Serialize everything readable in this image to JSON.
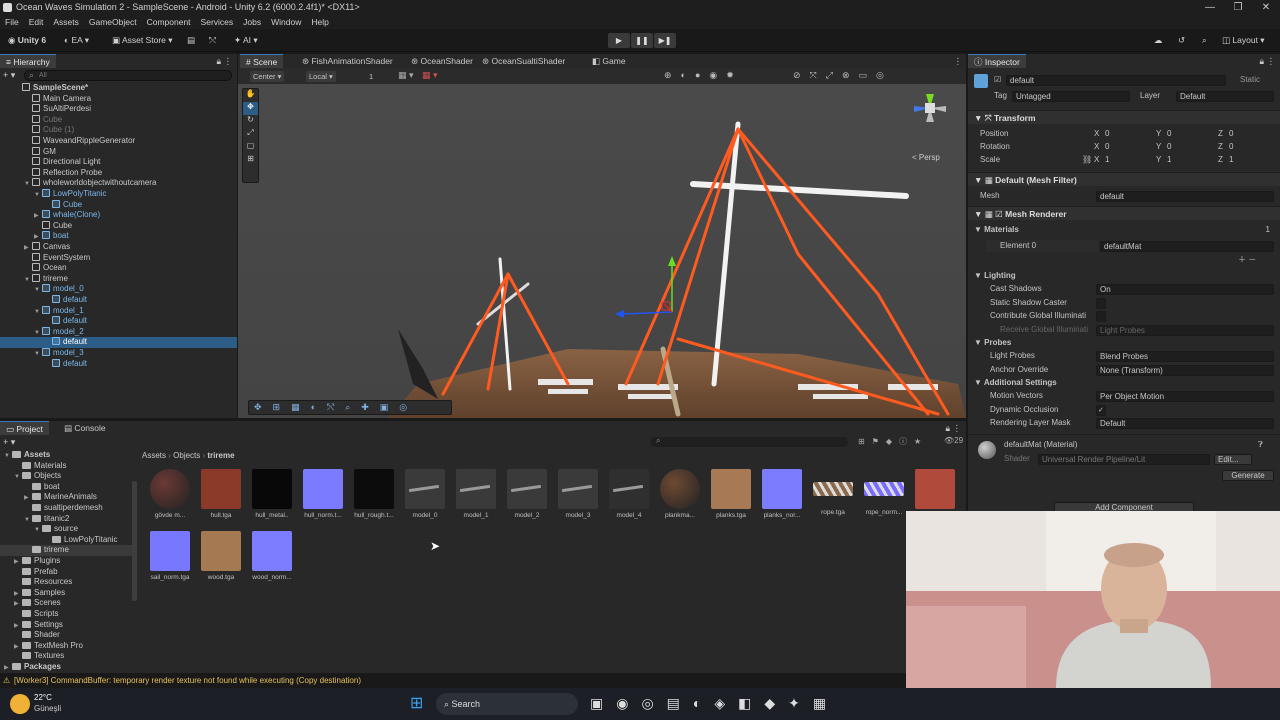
{
  "window": {
    "title": "Ocean Waves Simulation 2 - SampleScene - Android - Unity 6.2 (6000.2.4f1)* <DX11>",
    "controls": [
      "—",
      "❐",
      "✕"
    ]
  },
  "menu": [
    "File",
    "Edit",
    "Assets",
    "GameObject",
    "Component",
    "Services",
    "Jobs",
    "Window",
    "Help"
  ],
  "toolbar": {
    "unity": "Unity 6",
    "account": "EA",
    "asset_store": "Asset Store",
    "ai": "AI",
    "layout": "Layout"
  },
  "hierarchy": {
    "title": "Hierarchy",
    "search_placeholder": "All",
    "items": [
      {
        "label": "SampleScene*",
        "depth": 0,
        "style": "scene"
      },
      {
        "label": "Main Camera",
        "depth": 1,
        "style": ""
      },
      {
        "label": "SuAltiPerdesi",
        "depth": 1,
        "style": ""
      },
      {
        "label": "Cube",
        "depth": 1,
        "style": "dim"
      },
      {
        "label": "Cube (1)",
        "depth": 1,
        "style": "dim"
      },
      {
        "label": "WaveandRippleGenerator",
        "depth": 1,
        "style": ""
      },
      {
        "label": "GM",
        "depth": 1,
        "style": ""
      },
      {
        "label": "Directional Light",
        "depth": 1,
        "style": ""
      },
      {
        "label": "Reflection Probe",
        "depth": 1,
        "style": ""
      },
      {
        "label": "wholeworldobjectwithoutcamera",
        "depth": 1,
        "style": "",
        "arrow": "▼"
      },
      {
        "label": "LowPolyTitanic",
        "depth": 2,
        "style": "blue",
        "arrow": "▼"
      },
      {
        "label": "Cube",
        "depth": 3,
        "style": "blue"
      },
      {
        "label": "whale(Clone)",
        "depth": 2,
        "style": "blue",
        "arrow": "▶"
      },
      {
        "label": "Cube",
        "depth": 2,
        "style": ""
      },
      {
        "label": "boat",
        "depth": 2,
        "style": "blue",
        "arrow": "▶"
      },
      {
        "label": "Canvas",
        "depth": 1,
        "style": "",
        "arrow": "▶"
      },
      {
        "label": "EventSystem",
        "depth": 1,
        "style": ""
      },
      {
        "label": "Ocean",
        "depth": 1,
        "style": ""
      },
      {
        "label": "trireme",
        "depth": 1,
        "style": "",
        "arrow": "▼"
      },
      {
        "label": "model_0",
        "depth": 2,
        "style": "blue",
        "arrow": "▼"
      },
      {
        "label": "default",
        "depth": 3,
        "style": "blue"
      },
      {
        "label": "model_1",
        "depth": 2,
        "style": "blue",
        "arrow": "▼"
      },
      {
        "label": "default",
        "depth": 3,
        "style": "blue"
      },
      {
        "label": "model_2",
        "depth": 2,
        "style": "blue",
        "arrow": "▼"
      },
      {
        "label": "default",
        "depth": 3,
        "style": "sel"
      },
      {
        "label": "model_3",
        "depth": 2,
        "style": "blue",
        "arrow": "▼"
      },
      {
        "label": "default",
        "depth": 3,
        "style": "blue"
      }
    ]
  },
  "scene": {
    "tabs": [
      "Scene",
      "FishAnimationShader",
      "OceanShader",
      "OceanSualtiShader",
      "Game"
    ],
    "pivot": "Center",
    "space": "Local",
    "grid_snap": "1",
    "persp": "< Persp"
  },
  "inspector": {
    "title": "Inspector",
    "object_name": "default",
    "static_label": "Static",
    "tag_label": "Tag",
    "tag_value": "Untagged",
    "layer_label": "Layer",
    "layer_value": "Default",
    "transform": {
      "title": "Transform",
      "position_label": "Position",
      "rotation_label": "Rotation",
      "scale_label": "Scale",
      "position": [
        "0",
        "0",
        "0"
      ],
      "rotation": [
        "0",
        "0",
        "0"
      ],
      "scale": [
        "1",
        "1",
        "1"
      ]
    },
    "mesh_filter": {
      "title": "Default (Mesh Filter)",
      "mesh_label": "Mesh",
      "mesh_value": "default"
    },
    "mesh_renderer": {
      "title": "Mesh Renderer",
      "materials_label": "Materials",
      "materials_count": "1",
      "element_label": "Element 0",
      "element_value": "defaultMat",
      "lighting_label": "Lighting",
      "cast_shadows_label": "Cast Shadows",
      "cast_shadows_value": "On",
      "static_caster_label": "Static Shadow Caster",
      "contribute_label": "Contribute Global Illuminati",
      "receive_label": "Receive Global Illuminati",
      "receive_value": "Light Probes",
      "probes_label": "Probes",
      "light_probes_label": "Light Probes",
      "light_probes_value": "Blend Probes",
      "anchor_label": "Anchor Override",
      "anchor_value": "None (Transform)",
      "additional_label": "Additional Settings",
      "motion_label": "Motion Vectors",
      "motion_value": "Per Object Motion",
      "occlusion_label": "Dynamic Occlusion",
      "rendering_label": "Rendering Layer Mask",
      "rendering_value": "Default"
    },
    "material": {
      "name": "defaultMat (Material)",
      "shader_label": "Shader",
      "shader_value": "Universal Render Pipeline/Lit",
      "edit": "Edit...",
      "generate": "Generate"
    },
    "add_component": "Add Component"
  },
  "project": {
    "tabs": [
      "Project",
      "Console"
    ],
    "breadcrumb": [
      "Assets",
      "Objects",
      "trireme"
    ],
    "count": "29",
    "tree": [
      {
        "label": "Assets",
        "depth": 0,
        "arrow": "▼",
        "bold": true
      },
      {
        "label": "Materials",
        "depth": 1
      },
      {
        "label": "Objects",
        "depth": 1,
        "arrow": "▼"
      },
      {
        "label": "boat",
        "depth": 2
      },
      {
        "label": "MarineAnimals",
        "depth": 2,
        "arrow": "▶"
      },
      {
        "label": "sualtiperdemesh",
        "depth": 2
      },
      {
        "label": "titanic2",
        "depth": 2,
        "arrow": "▼"
      },
      {
        "label": "source",
        "depth": 3,
        "arrow": "▼"
      },
      {
        "label": "LowPolyTitanic",
        "depth": 4
      },
      {
        "label": "trireme",
        "depth": 2,
        "sel": true
      },
      {
        "label": "Plugins",
        "depth": 1,
        "arrow": "▶"
      },
      {
        "label": "Prefab",
        "depth": 1
      },
      {
        "label": "Resources",
        "depth": 1
      },
      {
        "label": "Samples",
        "depth": 1,
        "arrow": "▶"
      },
      {
        "label": "Scenes",
        "depth": 1,
        "arrow": "▶"
      },
      {
        "label": "Scripts",
        "depth": 1
      },
      {
        "label": "Settings",
        "depth": 1,
        "arrow": "▶"
      },
      {
        "label": "Shader",
        "depth": 1
      },
      {
        "label": "TextMesh Pro",
        "depth": 1,
        "arrow": "▶"
      },
      {
        "label": "Textures",
        "depth": 1
      },
      {
        "label": "Packages",
        "depth": 0,
        "arrow": "▶",
        "bold": true
      }
    ],
    "assets": [
      {
        "label": "gövde m...",
        "kind": "sphere",
        "color": "#6b3a34"
      },
      {
        "label": "hull.tga",
        "kind": "tex",
        "color": "#8b3a2a"
      },
      {
        "label": "hull_metal..",
        "kind": "tex",
        "color": "#080808"
      },
      {
        "label": "hull_norm.t...",
        "kind": "tex",
        "color": "#7b7bff"
      },
      {
        "label": "hull_rough.t...",
        "kind": "tex",
        "color": "#0c0c0c"
      },
      {
        "label": "model_0",
        "kind": "model",
        "color": "#3a3a3a"
      },
      {
        "label": "model_1",
        "kind": "model",
        "color": "#3a3a3a"
      },
      {
        "label": "model_2",
        "kind": "model",
        "color": "#3a3a3a"
      },
      {
        "label": "model_3",
        "kind": "model",
        "color": "#3a3a3a"
      },
      {
        "label": "model_4",
        "kind": "model",
        "color": "#2f2f2f"
      },
      {
        "label": "plankma...",
        "kind": "sphere",
        "color": "#6e4a33"
      },
      {
        "label": "planks.tga",
        "kind": "tex",
        "color": "#a77a55"
      },
      {
        "label": "planks_nor...",
        "kind": "tex",
        "color": "#7c7cff"
      },
      {
        "label": "rope.tga",
        "kind": "rope",
        "color": "#8a6a4a"
      },
      {
        "label": "rope_norm...",
        "kind": "rope",
        "color": "#7a6cff"
      },
      {
        "label": "",
        "kind": "tex",
        "color": "#b04a3a"
      },
      {
        "label": "sail_norm.tga",
        "kind": "tex",
        "color": "#7878ff"
      },
      {
        "label": "wood.tga",
        "kind": "tex",
        "color": "#a57a52"
      },
      {
        "label": "wood_norm...",
        "kind": "tex",
        "color": "#7d7dff"
      }
    ]
  },
  "status": {
    "message": "[Worker3] CommandBuffer: temporary render texture  not found while executing  (Copy destination)"
  },
  "taskbar": {
    "temperature": "22°C",
    "weather": "Güneşli",
    "search": "Search"
  }
}
